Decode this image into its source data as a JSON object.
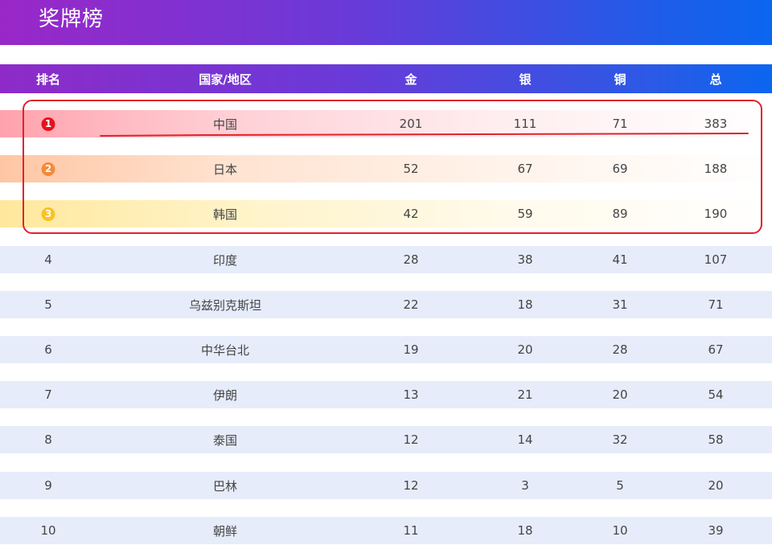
{
  "title": "奖牌榜",
  "headers": [
    "排名",
    "国家/地区",
    "金",
    "银",
    "铜",
    "总"
  ],
  "medal_badge_colors": {
    "1": "#e8101e",
    "2": "#f58a3a",
    "3": "#f8c325"
  },
  "annotation_color": "#e0232d",
  "rows": [
    {
      "rank": "1",
      "country": "中国",
      "gold": "201",
      "silver": "111",
      "bronze": "71",
      "total": "383"
    },
    {
      "rank": "2",
      "country": "日本",
      "gold": "52",
      "silver": "67",
      "bronze": "69",
      "total": "188"
    },
    {
      "rank": "3",
      "country": "韩国",
      "gold": "42",
      "silver": "59",
      "bronze": "89",
      "total": "190"
    },
    {
      "rank": "4",
      "country": "印度",
      "gold": "28",
      "silver": "38",
      "bronze": "41",
      "total": "107"
    },
    {
      "rank": "5",
      "country": "乌兹别克斯坦",
      "gold": "22",
      "silver": "18",
      "bronze": "31",
      "total": "71"
    },
    {
      "rank": "6",
      "country": "中华台北",
      "gold": "19",
      "silver": "20",
      "bronze": "28",
      "total": "67"
    },
    {
      "rank": "7",
      "country": "伊朗",
      "gold": "13",
      "silver": "21",
      "bronze": "20",
      "total": "54"
    },
    {
      "rank": "8",
      "country": "泰国",
      "gold": "12",
      "silver": "14",
      "bronze": "32",
      "total": "58"
    },
    {
      "rank": "9",
      "country": "巴林",
      "gold": "12",
      "silver": "3",
      "bronze": "5",
      "total": "20"
    },
    {
      "rank": "10",
      "country": "朝鲜",
      "gold": "11",
      "silver": "18",
      "bronze": "10",
      "total": "39"
    }
  ]
}
